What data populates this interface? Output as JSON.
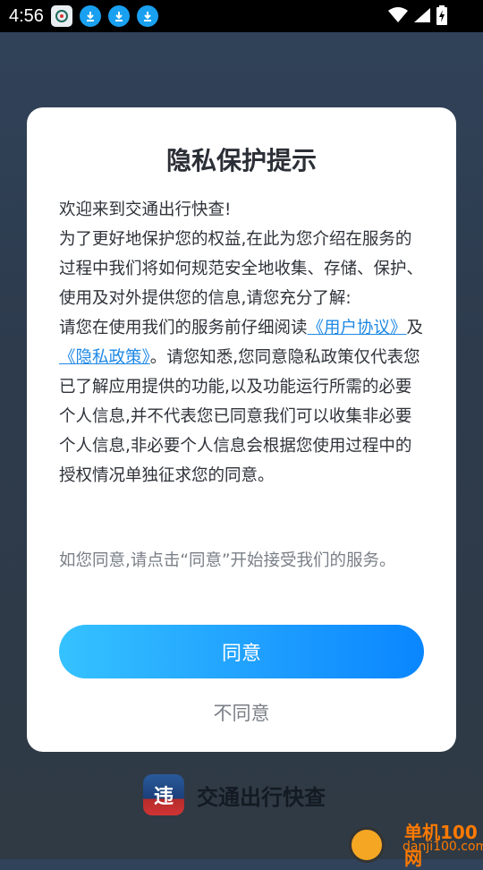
{
  "status_bar": {
    "time": "4:56"
  },
  "dialog": {
    "title": "隐私保护提示",
    "body": {
      "line1": "欢迎来到交通出行快查!",
      "para1": "为了更好地保护您的权益,在此为您介绍在服务的过程中我们将如何规范安全地收集、存储、保护、使用及对外提供您的信息,请您充分了解:",
      "para2_prefix": "请您在使用我们的服务前仔细阅读",
      "link_user_agreement": "《用户协议》",
      "and": "及",
      "link_privacy_policy": "《隐私政策》",
      "para2_suffix": "。请您知悉,您同意隐私政策仅代表您已了解应用提供的功能,以及功能运行所需的必要个人信息,并不代表您已同意我们可以收集非必要个人信息,非必要个人信息会根据您使用过程中的授权情况单独征求您的同意。"
    },
    "hint": "如您同意,请点击“同意”开始接受我们的服务。",
    "agree_label": "同意",
    "disagree_label": "不同意"
  },
  "app_brand": {
    "name": "交通出行快查",
    "logo_char": "违"
  },
  "watermark": {
    "title": "单机100网",
    "url": "danji100.com"
  },
  "colors": {
    "accent": "#1d9cff",
    "link": "#1e88e5",
    "status_bg": "#000000"
  }
}
